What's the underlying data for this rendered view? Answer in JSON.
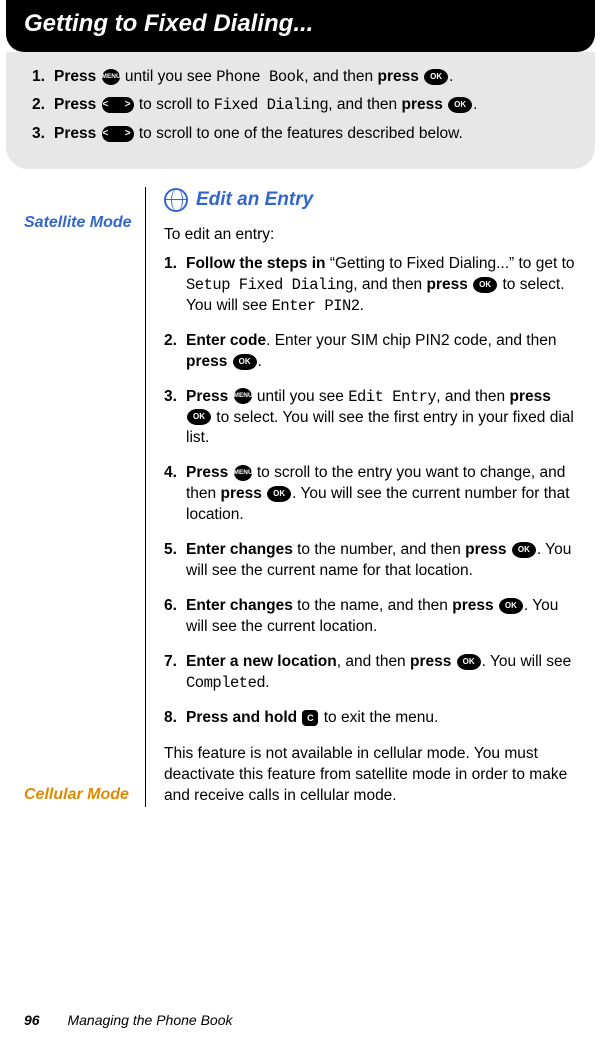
{
  "title": "Getting to Fixed Dialing...",
  "topSteps": [
    {
      "num": "1.",
      "parts": [
        {
          "t": "b",
          "v": "Press "
        },
        {
          "t": "icon",
          "v": "menu"
        },
        {
          "t": "n",
          "v": " until you see "
        },
        {
          "t": "lcd",
          "v": "Phone Book"
        },
        {
          "t": "n",
          "v": ", and then "
        },
        {
          "t": "b",
          "v": "press "
        },
        {
          "t": "icon",
          "v": "ok"
        },
        {
          "t": "n",
          "v": "."
        }
      ]
    },
    {
      "num": "2.",
      "parts": [
        {
          "t": "b",
          "v": "Press "
        },
        {
          "t": "icon",
          "v": "scroll"
        },
        {
          "t": "n",
          "v": " to scroll to "
        },
        {
          "t": "lcd",
          "v": "Fixed Dialing"
        },
        {
          "t": "n",
          "v": ", and then "
        },
        {
          "t": "b",
          "v": "press "
        },
        {
          "t": "icon",
          "v": "ok"
        },
        {
          "t": "n",
          "v": "."
        }
      ]
    },
    {
      "num": "3.",
      "parts": [
        {
          "t": "b",
          "v": "Press "
        },
        {
          "t": "icon",
          "v": "scroll"
        },
        {
          "t": "n",
          "v": " to scroll to one of the features described below."
        }
      ]
    }
  ],
  "sectionHeading": "Edit an Entry",
  "satModeLabel": "Satellite Mode",
  "cellModeLabel": "Cellular Mode",
  "satIntro": "To edit an entry:",
  "satSteps": [
    {
      "num": "1.",
      "parts": [
        {
          "t": "b",
          "v": "Follow the steps in"
        },
        {
          "t": "n",
          "v": " “Getting to Fixed Dialing...” to get to "
        },
        {
          "t": "lcd",
          "v": "Setup Fixed Dialing"
        },
        {
          "t": "n",
          "v": ", and then "
        },
        {
          "t": "b",
          "v": "press "
        },
        {
          "t": "icon",
          "v": "ok"
        },
        {
          "t": "n",
          "v": " to select. You will see "
        },
        {
          "t": "lcd",
          "v": "Enter PIN2"
        },
        {
          "t": "n",
          "v": "."
        }
      ]
    },
    {
      "num": "2.",
      "parts": [
        {
          "t": "b",
          "v": "Enter code"
        },
        {
          "t": "n",
          "v": ". Enter your SIM chip PIN2 code, and then "
        },
        {
          "t": "b",
          "v": "press "
        },
        {
          "t": "icon",
          "v": "ok"
        },
        {
          "t": "n",
          "v": "."
        }
      ]
    },
    {
      "num": "3.",
      "parts": [
        {
          "t": "b",
          "v": "Press "
        },
        {
          "t": "icon",
          "v": "menu"
        },
        {
          "t": "n",
          "v": " until you see "
        },
        {
          "t": "lcd",
          "v": "Edit Entry"
        },
        {
          "t": "n",
          "v": ", and then "
        },
        {
          "t": "b",
          "v": "press "
        },
        {
          "t": "icon",
          "v": "ok"
        },
        {
          "t": "n",
          "v": " to select. You will see the first entry in your fixed dial list."
        }
      ]
    },
    {
      "num": "4.",
      "parts": [
        {
          "t": "b",
          "v": "Press "
        },
        {
          "t": "icon",
          "v": "menu"
        },
        {
          "t": "n",
          "v": " to scroll to the entry you want to change, and then "
        },
        {
          "t": "b",
          "v": "press "
        },
        {
          "t": "icon",
          "v": "ok"
        },
        {
          "t": "n",
          "v": ". You will see the current number for that location."
        }
      ]
    },
    {
      "num": "5.",
      "parts": [
        {
          "t": "b",
          "v": "Enter changes"
        },
        {
          "t": "n",
          "v": " to the number, and then "
        },
        {
          "t": "b",
          "v": "press "
        },
        {
          "t": "icon",
          "v": "ok"
        },
        {
          "t": "n",
          "v": ". You will see the current name for that location."
        }
      ]
    },
    {
      "num": "6.",
      "parts": [
        {
          "t": "b",
          "v": "Enter changes"
        },
        {
          "t": "n",
          "v": " to the name, and then "
        },
        {
          "t": "b",
          "v": "press "
        },
        {
          "t": "icon",
          "v": "ok"
        },
        {
          "t": "n",
          "v": ". You will see the current location."
        }
      ]
    },
    {
      "num": "7.",
      "parts": [
        {
          "t": "b",
          "v": "Enter a new location"
        },
        {
          "t": "n",
          "v": ", and then "
        },
        {
          "t": "b",
          "v": "press "
        },
        {
          "t": "icon",
          "v": "ok"
        },
        {
          "t": "n",
          "v": ". You will see "
        },
        {
          "t": "lcd",
          "v": "Completed"
        },
        {
          "t": "n",
          "v": "."
        }
      ]
    },
    {
      "num": "8.",
      "parts": [
        {
          "t": "b",
          "v": "Press and hold "
        },
        {
          "t": "icon",
          "v": "c"
        },
        {
          "t": "n",
          "v": " to exit the menu."
        }
      ]
    }
  ],
  "cellText": "This feature is not available in cellular mode. You must deactivate this feature from satellite mode in order to make and receive calls in cellular mode.",
  "pageNum": "96",
  "chapter": "Managing the Phone Book",
  "icons": {
    "menu": "MENU",
    "ok": "OK",
    "scroll": "<   >",
    "c": "C"
  }
}
